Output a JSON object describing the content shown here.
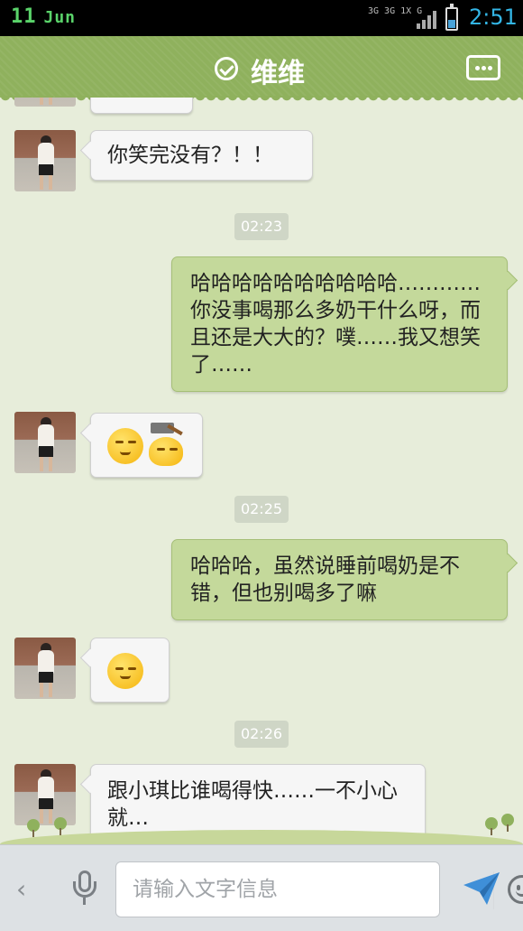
{
  "status_bar": {
    "date_day": "11",
    "date_month": "Jun",
    "network_top": "3G 3G 1X G",
    "time": "2:51"
  },
  "header": {
    "title": "维维"
  },
  "messages": [
    {
      "type": "in",
      "text": "你笑完没有？！！"
    },
    {
      "type": "time",
      "text": "02:23"
    },
    {
      "type": "out",
      "text": "哈哈哈哈哈哈哈哈哈哈…………你没事喝那么多奶干什么呀，而且还是大大的？噗……我又想笑了……"
    },
    {
      "type": "in_emoji",
      "emojis": [
        "smirk-face",
        "hammer-face"
      ]
    },
    {
      "type": "time",
      "text": "02:25"
    },
    {
      "type": "out",
      "text": "哈哈哈，虽然说睡前喝奶是不错，但也别喝多了嘛"
    },
    {
      "type": "in_emoji",
      "emojis": [
        "shy-face"
      ]
    },
    {
      "type": "time",
      "text": "02:26"
    },
    {
      "type": "in",
      "text": "跟小琪比谁喝得快……一不小心就…"
    }
  ],
  "input_bar": {
    "placeholder": "请输入文字信息"
  },
  "colors": {
    "header_green": "#8fb15d",
    "out_bubble": "#c4d99b",
    "in_bubble": "#f6f6f6",
    "status_time_blue": "#33b5e5"
  }
}
